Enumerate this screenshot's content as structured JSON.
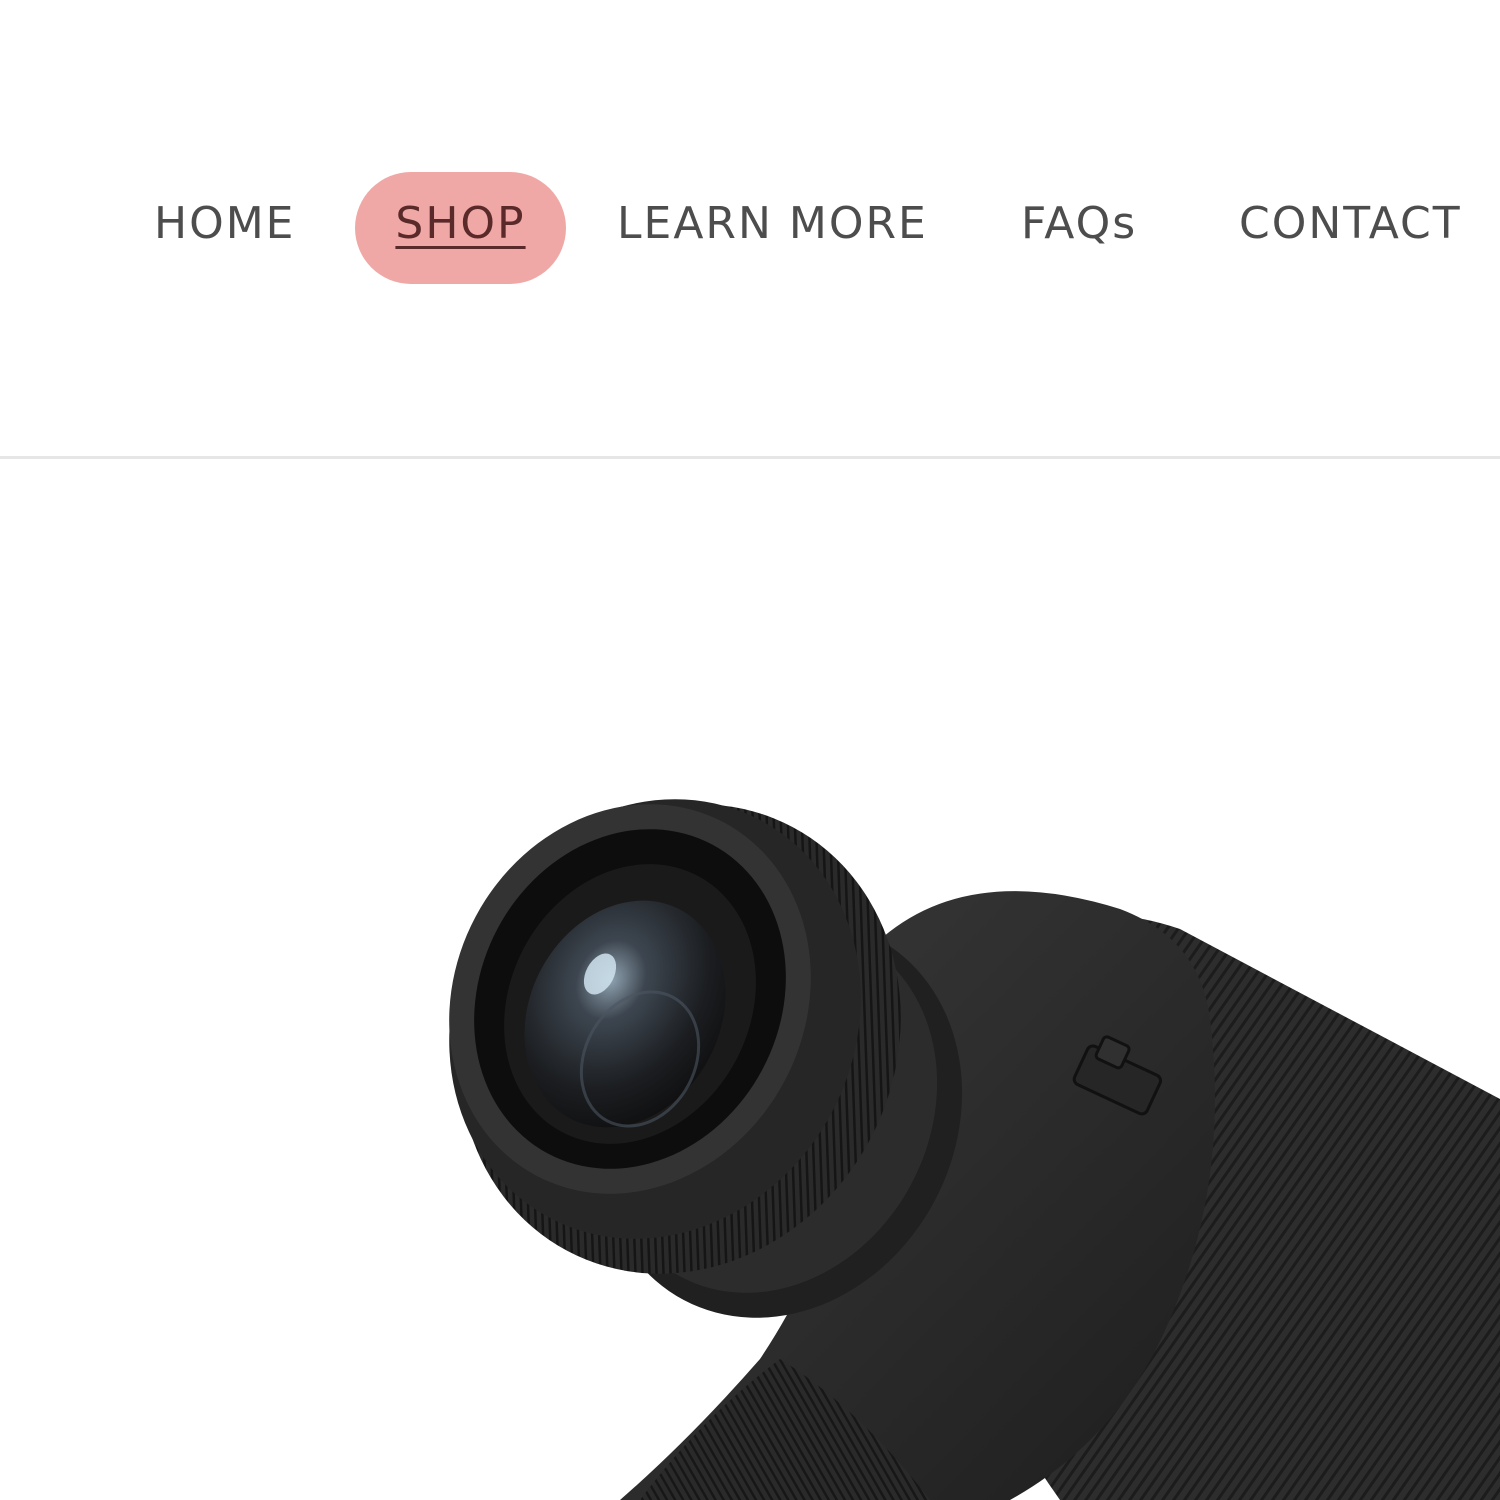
{
  "nav": {
    "items": [
      {
        "label": "HOME"
      },
      {
        "label": "SHOP"
      },
      {
        "label": "LEARN MORE"
      },
      {
        "label": "FAQs"
      },
      {
        "label": "CONTACT"
      }
    ],
    "active_index": 1
  },
  "colors": {
    "active_pill": "#f0a8a6",
    "nav_text": "#4d4d4d",
    "product": "#2b2b2b"
  },
  "hero": {
    "product_image": "camera-lens-product-icon"
  }
}
